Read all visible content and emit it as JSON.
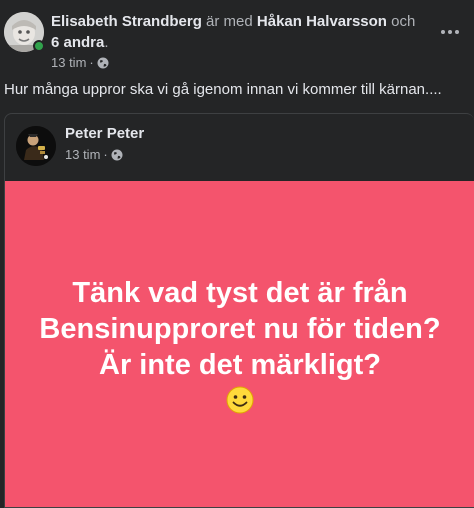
{
  "post": {
    "author": "Elisabeth Strandberg",
    "with_text": "är med",
    "tagged_person": "Håkan Halvarsson",
    "and_text": "och",
    "others": "6 andra",
    "period": ".",
    "time": "13 tim",
    "dot": "·",
    "audience_icon": "globe-icon",
    "more_icon": "more-options-icon",
    "text": "Hur många uppror ska vi gå igenom innan vi kommer till kärnan...."
  },
  "shared": {
    "author": "Peter Peter",
    "time": "13 tim",
    "dot": "·",
    "audience_icon": "globe-icon",
    "status_text": "Tänk vad tyst det är från Bensinupproret nu för tiden? Är inte det märkligt?",
    "status_emoji": "smiling-face-emoji",
    "background_color": "#f4546d"
  },
  "colors": {
    "surface": "#242526",
    "primary_text": "#e4e6eb",
    "secondary_text": "#b0b3b8",
    "online": "#31a24c"
  }
}
